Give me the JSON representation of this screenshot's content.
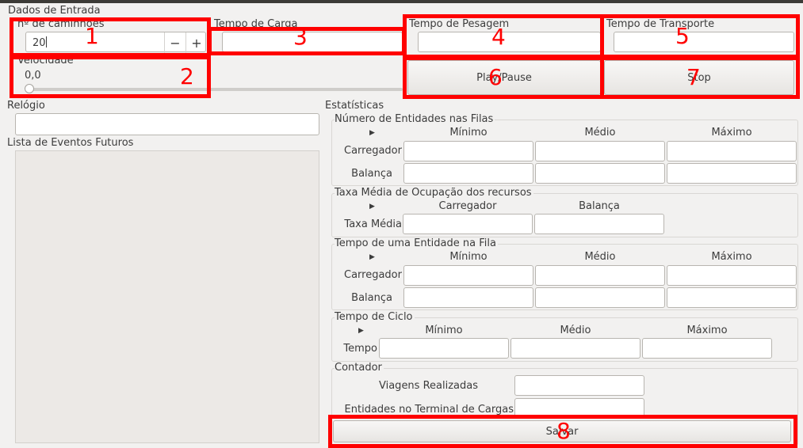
{
  "window": {
    "dados_entrada_title": "Dados de Entrada",
    "relogio_title": "Relógio",
    "lista_eventos_title": "Lista de Eventos Futuros",
    "estatisticas_title": "Estatísticas"
  },
  "inputs": {
    "caminhoes_label": "nº de caminhões",
    "caminhoes_value": "20",
    "spin_minus": "−",
    "spin_plus": "+",
    "tempo_carga_label": "Tempo de Carga",
    "tempo_pesagem_label": "Tempo de Pesagem",
    "tempo_transporte_label": "Tempo de Transporte",
    "velocidade_label": "Velocidade",
    "velocidade_value": "0,0",
    "velocidade_level": 0
  },
  "buttons": {
    "play_pause": "Play/Pause",
    "stop": "Stop",
    "salvar": "Salvar"
  },
  "stats": {
    "entidades_filas": {
      "title": "Número de Entidades nas Filas",
      "columns": [
        "Mínimo",
        "Médio",
        "Máximo"
      ],
      "rows": [
        "Carregador",
        "Balança"
      ]
    },
    "taxa_ocupacao": {
      "title": "Taxa Média de Ocupação dos recursos",
      "columns": [
        "Carregador",
        "Balança"
      ],
      "row": "Taxa Média"
    },
    "tempo_fila": {
      "title": "Tempo de uma Entidade na Fila",
      "columns": [
        "Mínimo",
        "Médio",
        "Máximo"
      ],
      "rows": [
        "Carregador",
        "Balança"
      ]
    },
    "tempo_ciclo": {
      "title": "Tempo de Ciclo",
      "columns": [
        "Mínimo",
        "Médio",
        "Máximo"
      ],
      "row": "Tempo"
    },
    "contador": {
      "title": "Contador",
      "viagens": "Viagens Realizadas",
      "entidades_terminal": "Entidades no Terminal de Cargas"
    }
  },
  "annotations": {
    "color": "#ff0000",
    "labels": [
      "1",
      "2",
      "3",
      "4",
      "5",
      "6",
      "7",
      "8"
    ]
  }
}
